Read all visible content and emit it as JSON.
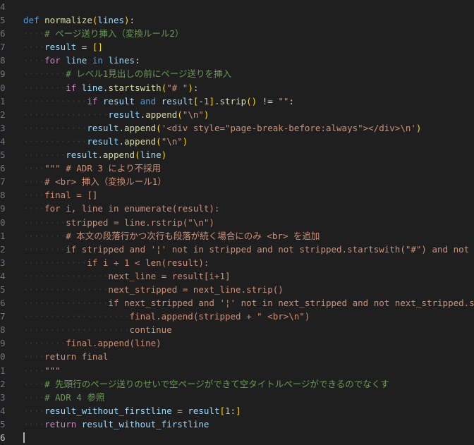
{
  "editor": {
    "current_line": "6",
    "lines": [
      {
        "n": "4",
        "segments": []
      },
      {
        "n": "5",
        "segments": [
          [
            "keyword",
            "def "
          ],
          [
            "func",
            "normalize"
          ],
          [
            "bracket1",
            "("
          ],
          [
            "var",
            "lines"
          ],
          [
            "bracket1",
            ")"
          ],
          [
            "plain",
            ":"
          ]
        ]
      },
      {
        "n": "6",
        "segments": [
          [
            "guide",
            "····"
          ],
          [
            "comment",
            "# ページ送り挿入（変換ルール2）"
          ]
        ]
      },
      {
        "n": "7",
        "segments": [
          [
            "guide",
            "····"
          ],
          [
            "var",
            "result"
          ],
          [
            "plain",
            " = "
          ],
          [
            "bracket1",
            "[]"
          ]
        ]
      },
      {
        "n": "8",
        "segments": [
          [
            "guide",
            "····"
          ],
          [
            "control",
            "for "
          ],
          [
            "var",
            "line"
          ],
          [
            "keyword",
            " in "
          ],
          [
            "var",
            "lines"
          ],
          [
            "plain",
            ":"
          ]
        ]
      },
      {
        "n": "9",
        "segments": [
          [
            "guide",
            "········"
          ],
          [
            "comment",
            "# レベル1見出しの前にページ送りを挿入"
          ]
        ]
      },
      {
        "n": "0",
        "segments": [
          [
            "guide",
            "········"
          ],
          [
            "control",
            "if "
          ],
          [
            "var",
            "line"
          ],
          [
            "plain",
            "."
          ],
          [
            "func",
            "startswith"
          ],
          [
            "bracket1",
            "("
          ],
          [
            "string",
            "\"# \""
          ],
          [
            "bracket1",
            ")"
          ],
          [
            "plain",
            ":"
          ]
        ]
      },
      {
        "n": "1",
        "segments": [
          [
            "guide",
            "············"
          ],
          [
            "control",
            "if "
          ],
          [
            "var",
            "result "
          ],
          [
            "keyword",
            "and "
          ],
          [
            "var",
            "result"
          ],
          [
            "bracket1",
            "["
          ],
          [
            "plain",
            "-"
          ],
          [
            "number",
            "1"
          ],
          [
            "bracket1",
            "]"
          ],
          [
            "plain",
            "."
          ],
          [
            "func",
            "strip"
          ],
          [
            "bracket1",
            "()"
          ],
          [
            "plain",
            " != "
          ],
          [
            "string",
            "\"\""
          ],
          [
            "plain",
            ":"
          ]
        ]
      },
      {
        "n": "2",
        "segments": [
          [
            "guide",
            "················"
          ],
          [
            "var",
            "result"
          ],
          [
            "plain",
            "."
          ],
          [
            "func",
            "append"
          ],
          [
            "bracket1",
            "("
          ],
          [
            "string",
            "\"\\n\""
          ],
          [
            "bracket1",
            ")"
          ]
        ]
      },
      {
        "n": "3",
        "segments": [
          [
            "guide",
            "············"
          ],
          [
            "var",
            "result"
          ],
          [
            "plain",
            "."
          ],
          [
            "func",
            "append"
          ],
          [
            "bracket1",
            "("
          ],
          [
            "string",
            "'<div style=\"page-break-before:always\"></div>\\n'"
          ],
          [
            "bracket1",
            ")"
          ]
        ]
      },
      {
        "n": "4",
        "segments": [
          [
            "guide",
            "············"
          ],
          [
            "var",
            "result"
          ],
          [
            "plain",
            "."
          ],
          [
            "func",
            "append"
          ],
          [
            "bracket1",
            "("
          ],
          [
            "string",
            "\"\\n\""
          ],
          [
            "bracket1",
            ")"
          ]
        ]
      },
      {
        "n": "5",
        "segments": [
          [
            "guide",
            "········"
          ],
          [
            "var",
            "result"
          ],
          [
            "plain",
            "."
          ],
          [
            "func",
            "append"
          ],
          [
            "bracket1",
            "("
          ],
          [
            "var",
            "line"
          ],
          [
            "bracket1",
            ")"
          ]
        ]
      },
      {
        "n": "6",
        "segments": [
          [
            "guide",
            "····"
          ],
          [
            "string",
            "\"\"\" # ADR 3 により不採用"
          ]
        ]
      },
      {
        "n": "7",
        "segments": [
          [
            "guide",
            "····"
          ],
          [
            "string",
            "# <br> 挿入（変換ルール1）"
          ]
        ]
      },
      {
        "n": "8",
        "segments": [
          [
            "guide",
            "····"
          ],
          [
            "string",
            "final = []"
          ]
        ]
      },
      {
        "n": "9",
        "segments": [
          [
            "guide",
            "····"
          ],
          [
            "string",
            "for i, line in enumerate(result):"
          ]
        ]
      },
      {
        "n": "0",
        "segments": [
          [
            "guide",
            "········"
          ],
          [
            "string",
            "stripped = line.rstrip(\"\\n\")"
          ]
        ]
      },
      {
        "n": "1",
        "segments": [
          [
            "guide",
            "········"
          ],
          [
            "string",
            "# 本文の段落行かつ次行も段落が続く場合にのみ <br> を追加"
          ]
        ]
      },
      {
        "n": "2",
        "segments": [
          [
            "guide",
            "········"
          ],
          [
            "string",
            "if stripped and '¦' not in stripped and not stripped.startswith(\"#\") and not st"
          ]
        ]
      },
      {
        "n": "3",
        "segments": [
          [
            "guide",
            "············"
          ],
          [
            "string",
            "if i + 1 < len(result):"
          ]
        ]
      },
      {
        "n": "4",
        "segments": [
          [
            "guide",
            "················"
          ],
          [
            "string",
            "next_line = result[i+1]"
          ]
        ]
      },
      {
        "n": "5",
        "segments": [
          [
            "guide",
            "················"
          ],
          [
            "string",
            "next_stripped = next_line.strip()"
          ]
        ]
      },
      {
        "n": "6",
        "segments": [
          [
            "guide",
            "················"
          ],
          [
            "string",
            "if next_stripped and '¦' not in next_stripped and not next_stripped.sta"
          ]
        ]
      },
      {
        "n": "7",
        "segments": [
          [
            "guide",
            "····················"
          ],
          [
            "string",
            "final.append(stripped + \" <br>\\n\")"
          ]
        ]
      },
      {
        "n": "8",
        "segments": [
          [
            "guide",
            "····················"
          ],
          [
            "string",
            "continue"
          ]
        ]
      },
      {
        "n": "9",
        "segments": [
          [
            "guide",
            "········"
          ],
          [
            "string",
            "final.append(line)"
          ]
        ]
      },
      {
        "n": "0",
        "segments": [
          [
            "guide",
            "····"
          ],
          [
            "string",
            "return final"
          ]
        ]
      },
      {
        "n": "1",
        "segments": [
          [
            "guide",
            "····"
          ],
          [
            "string",
            "\"\"\""
          ]
        ]
      },
      {
        "n": "2",
        "segments": [
          [
            "guide",
            "····"
          ],
          [
            "comment",
            "# 先頭行のページ送りのせいで空ページができて空タイトルページができるのでなくす"
          ]
        ]
      },
      {
        "n": "3",
        "segments": [
          [
            "guide",
            "····"
          ],
          [
            "comment",
            "# ADR 4 参照"
          ]
        ]
      },
      {
        "n": "4",
        "segments": [
          [
            "guide",
            "····"
          ],
          [
            "var",
            "result_without_firstline"
          ],
          [
            "plain",
            " = "
          ],
          [
            "var",
            "result"
          ],
          [
            "bracket1",
            "["
          ],
          [
            "number",
            "1"
          ],
          [
            "plain",
            ":"
          ],
          [
            "bracket1",
            "]"
          ]
        ]
      },
      {
        "n": "5",
        "segments": [
          [
            "guide",
            "····"
          ],
          [
            "control",
            "return "
          ],
          [
            "var",
            "result_without_firstline"
          ]
        ]
      },
      {
        "n": "6",
        "segments": [],
        "current": true
      }
    ]
  }
}
